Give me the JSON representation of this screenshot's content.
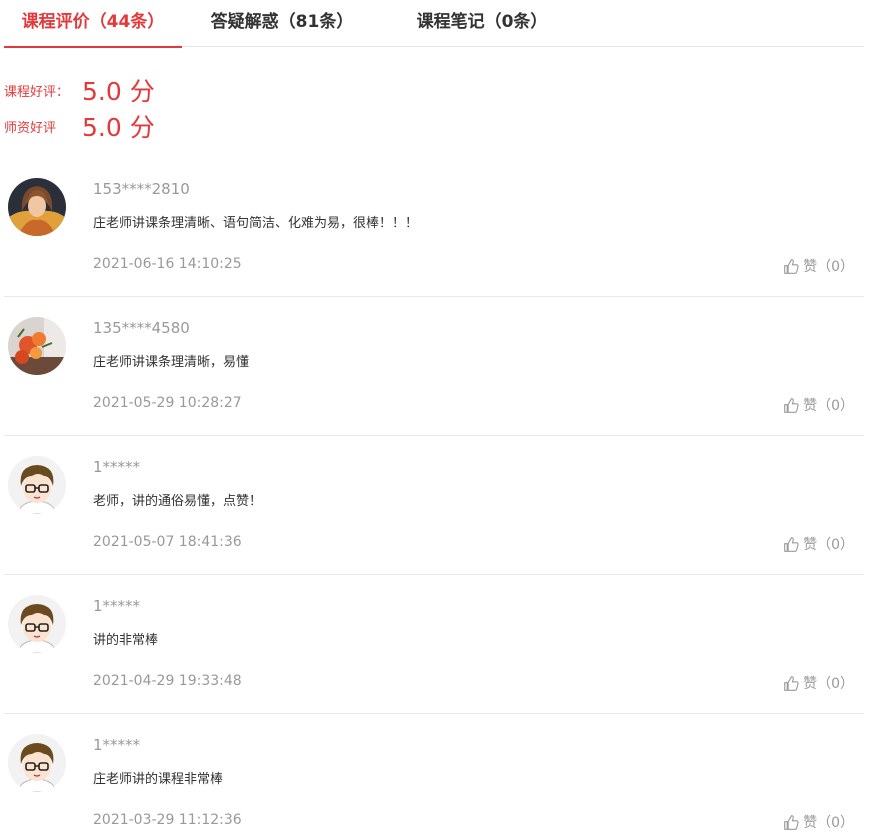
{
  "tabs": [
    {
      "label": "课程评价（44条）",
      "active": true
    },
    {
      "label": "答疑解惑（81条）",
      "active": false
    },
    {
      "label": "课程笔记（0条）",
      "active": false
    }
  ],
  "scores": [
    {
      "label": "课程好评：",
      "value": "5.0 分"
    },
    {
      "label": "师资好评",
      "value": "5.0 分"
    }
  ],
  "reviews": [
    {
      "user": "153****2810",
      "text": "庄老师讲课条理清晰、语句简洁、化难为易，很棒！！！",
      "time": "2021-06-16 14:10:25",
      "like": "赞（0）",
      "avatar": "avatar-photo-woman"
    },
    {
      "user": "135****4580",
      "text": "庄老师讲课条理清晰，易懂",
      "time": "2021-05-29 10:28:27",
      "like": "赞（0）",
      "avatar": "avatar-photo-flowers"
    },
    {
      "user": "1*****",
      "text": "老师，讲的通俗易懂，点赞！",
      "time": "2021-05-07 18:41:36",
      "like": "赞（0）",
      "avatar": "avatar-cartoon-boy"
    },
    {
      "user": "1*****",
      "text": "讲的非常棒",
      "time": "2021-04-29 19:33:48",
      "like": "赞（0）",
      "avatar": "avatar-cartoon-boy"
    },
    {
      "user": "1*****",
      "text": "庄老师讲的课程非常棒",
      "time": "2021-03-29 11:12:36",
      "like": "赞（0）",
      "avatar": "avatar-cartoon-boy"
    }
  ],
  "colors": {
    "accent": "#e4393c",
    "muted": "#999999",
    "divider": "#e8e8e8"
  }
}
